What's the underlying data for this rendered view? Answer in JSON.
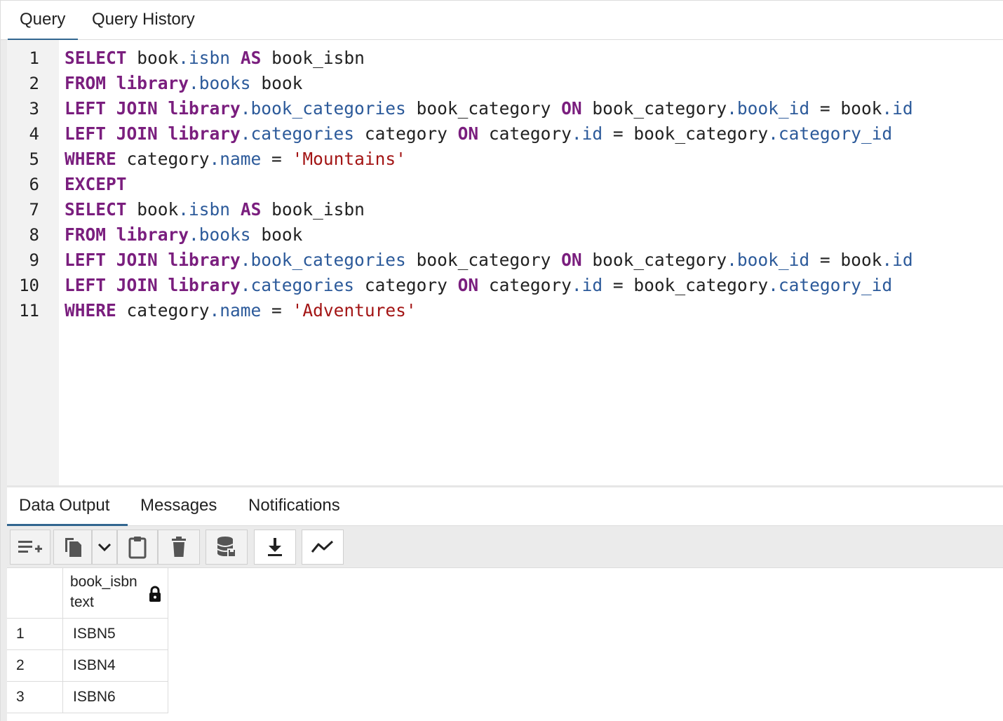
{
  "top_tabs": {
    "query": "Query",
    "history": "Query History"
  },
  "editor": {
    "lines": [
      [
        [
          "kw",
          "SELECT"
        ],
        [
          "plain",
          " book"
        ],
        [
          "prop",
          ".isbn"
        ],
        [
          "plain",
          " "
        ],
        [
          "kw",
          "AS"
        ],
        [
          "plain",
          " book_isbn"
        ]
      ],
      [
        [
          "kw",
          "FROM"
        ],
        [
          "plain",
          " "
        ],
        [
          "kw",
          "library"
        ],
        [
          "prop",
          ".books"
        ],
        [
          "plain",
          " book"
        ]
      ],
      [
        [
          "kw",
          "LEFT JOIN"
        ],
        [
          "plain",
          " "
        ],
        [
          "kw",
          "library"
        ],
        [
          "prop",
          ".book_categories"
        ],
        [
          "plain",
          " book_category "
        ],
        [
          "kw",
          "ON"
        ],
        [
          "plain",
          " book_category"
        ],
        [
          "prop",
          ".book_id"
        ],
        [
          "plain",
          " = book"
        ],
        [
          "prop",
          ".id"
        ]
      ],
      [
        [
          "kw",
          "LEFT JOIN"
        ],
        [
          "plain",
          " "
        ],
        [
          "kw",
          "library"
        ],
        [
          "prop",
          ".categories"
        ],
        [
          "plain",
          " category "
        ],
        [
          "kw",
          "ON"
        ],
        [
          "plain",
          " category"
        ],
        [
          "prop",
          ".id"
        ],
        [
          "plain",
          " = book_category"
        ],
        [
          "prop",
          ".category_id"
        ]
      ],
      [
        [
          "kw",
          "WHERE"
        ],
        [
          "plain",
          " category"
        ],
        [
          "prop",
          ".name"
        ],
        [
          "plain",
          " = "
        ],
        [
          "str",
          "'Mountains'"
        ]
      ],
      [
        [
          "kw",
          "EXCEPT"
        ]
      ],
      [
        [
          "kw",
          "SELECT"
        ],
        [
          "plain",
          " book"
        ],
        [
          "prop",
          ".isbn"
        ],
        [
          "plain",
          " "
        ],
        [
          "kw",
          "AS"
        ],
        [
          "plain",
          " book_isbn"
        ]
      ],
      [
        [
          "kw",
          "FROM"
        ],
        [
          "plain",
          " "
        ],
        [
          "kw",
          "library"
        ],
        [
          "prop",
          ".books"
        ],
        [
          "plain",
          " book"
        ]
      ],
      [
        [
          "kw",
          "LEFT JOIN"
        ],
        [
          "plain",
          " "
        ],
        [
          "kw",
          "library"
        ],
        [
          "prop",
          ".book_categories"
        ],
        [
          "plain",
          " book_category "
        ],
        [
          "kw",
          "ON"
        ],
        [
          "plain",
          " book_category"
        ],
        [
          "prop",
          ".book_id"
        ],
        [
          "plain",
          " = book"
        ],
        [
          "prop",
          ".id"
        ]
      ],
      [
        [
          "kw",
          "LEFT JOIN"
        ],
        [
          "plain",
          " "
        ],
        [
          "kw",
          "library"
        ],
        [
          "prop",
          ".categories"
        ],
        [
          "plain",
          " category "
        ],
        [
          "kw",
          "ON"
        ],
        [
          "plain",
          " category"
        ],
        [
          "prop",
          ".id"
        ],
        [
          "plain",
          " = book_category"
        ],
        [
          "prop",
          ".category_id"
        ]
      ],
      [
        [
          "kw",
          "WHERE"
        ],
        [
          "plain",
          " category"
        ],
        [
          "prop",
          ".name"
        ],
        [
          "plain",
          " = "
        ],
        [
          "str",
          "'Adventures'"
        ]
      ]
    ],
    "line_numbers": [
      "1",
      "2",
      "3",
      "4",
      "5",
      "6",
      "7",
      "8",
      "9",
      "10",
      "11"
    ]
  },
  "bottom_tabs": {
    "data_output": "Data Output",
    "messages": "Messages",
    "notifications": "Notifications"
  },
  "toolbar": {
    "buttons": [
      "add-row-icon",
      "copy-icon",
      "chevron-down-icon",
      "paste-icon",
      "delete-icon",
      "save-data-icon",
      "download-icon",
      "graph-icon"
    ]
  },
  "results": {
    "column": {
      "name": "book_isbn",
      "type": "text",
      "icon": "lock-icon"
    },
    "rows": [
      {
        "num": "1",
        "value": "ISBN5"
      },
      {
        "num": "2",
        "value": "ISBN4"
      },
      {
        "num": "3",
        "value": "ISBN6"
      }
    ]
  },
  "colors": {
    "keyword": "#7a1e7e",
    "property": "#2c5a9a",
    "string": "#a31515",
    "accent": "#326690"
  }
}
